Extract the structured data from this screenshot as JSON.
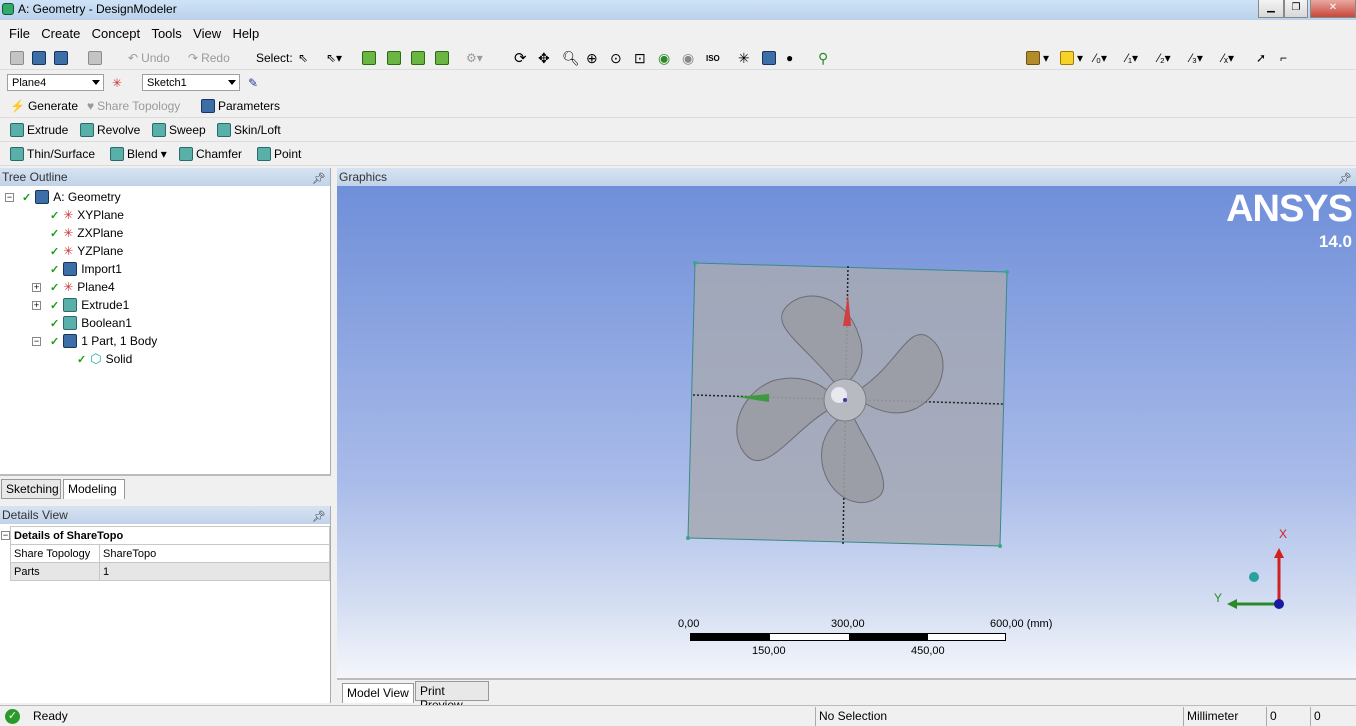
{
  "window": {
    "title": "A: Geometry - DesignModeler"
  },
  "menu": [
    "File",
    "Create",
    "Concept",
    "Tools",
    "View",
    "Help"
  ],
  "toolbar1": {
    "undo": "Undo",
    "redo": "Redo",
    "select_label": "Select:"
  },
  "toolbar2": {
    "plane": "Plane4",
    "sketch": "Sketch1"
  },
  "toolbar3": {
    "generate": "Generate",
    "share_topology": "Share Topology",
    "parameters": "Parameters"
  },
  "toolbar4": {
    "extrude": "Extrude",
    "revolve": "Revolve",
    "sweep": "Sweep",
    "skin_loft": "Skin/Loft"
  },
  "toolbar5": {
    "thin_surface": "Thin/Surface",
    "blend": "Blend",
    "chamfer": "Chamfer",
    "point": "Point"
  },
  "tree": {
    "header": "Tree Outline",
    "items": [
      {
        "label": "A: Geometry",
        "icon": "geometry-icon"
      },
      {
        "label": "XYPlane",
        "icon": "plane-axis-icon"
      },
      {
        "label": "ZXPlane",
        "icon": "plane-axis-icon"
      },
      {
        "label": "YZPlane",
        "icon": "plane-axis-icon"
      },
      {
        "label": "Import1",
        "icon": "import-icon"
      },
      {
        "label": "Plane4",
        "icon": "plane-axis-icon"
      },
      {
        "label": "Extrude1",
        "icon": "extrude-icon"
      },
      {
        "label": "Boolean1",
        "icon": "boolean-icon"
      },
      {
        "label": "1 Part, 1 Body",
        "icon": "part-icon"
      },
      {
        "label": "Solid",
        "icon": "solid-body-icon"
      }
    ],
    "tabs": [
      "Sketching",
      "Modeling"
    ]
  },
  "details": {
    "header": "Details View",
    "title": "Details of ShareTopo",
    "rows": [
      {
        "key": "Share Topology",
        "value": "ShareTopo"
      },
      {
        "key": "Parts",
        "value": "1"
      }
    ]
  },
  "graphics": {
    "header": "Graphics",
    "logo": "ANSYS",
    "version": "14.0",
    "scale_top": [
      "0,00",
      "300,00",
      "600,00 (mm)"
    ],
    "scale_bottom": [
      "150,00",
      "450,00"
    ],
    "triad": {
      "x": "X",
      "y": "Y"
    },
    "tabs": [
      "Model View",
      "Print Preview"
    ]
  },
  "status": {
    "ready": "Ready",
    "selection": "No Selection",
    "units": "Millimeter",
    "v1": "0",
    "v2": "0"
  }
}
